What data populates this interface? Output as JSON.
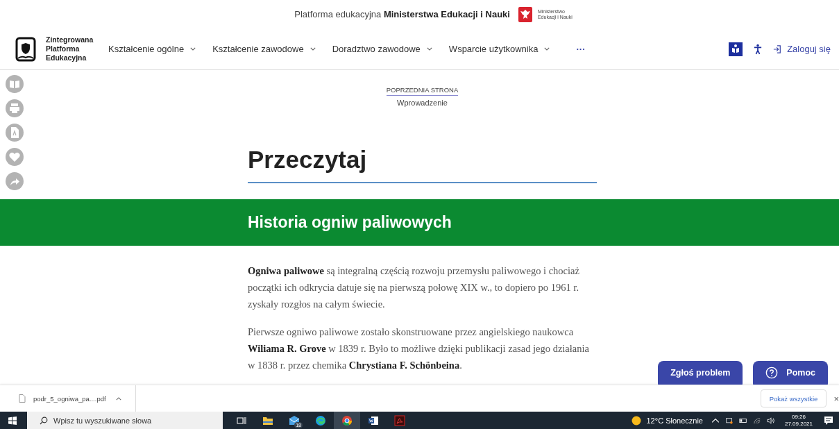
{
  "ministry_bar": {
    "text": "Platforma edukacyjna **Ministerstwa Edukacji i Nauki**",
    "logo_lines": [
      "Ministerstwo",
      "Edukacji i Nauki"
    ]
  },
  "nav": {
    "logo_lines": [
      "Zintegrowana",
      "Platforma",
      "Edukacyjna"
    ],
    "menu": [
      {
        "label": "Kształcenie ogólne",
        "has_dropdown": true
      },
      {
        "label": "Kształcenie zawodowe",
        "has_dropdown": true
      },
      {
        "label": "Doradztwo zawodowe",
        "has_dropdown": true
      },
      {
        "label": "Wsparcie użytkownika",
        "has_dropdown": true
      }
    ],
    "more": "···",
    "login": "Zaloguj się"
  },
  "breadcrumb": {
    "label": "POPRZEDNIA STRONA",
    "link": "Wprowadzenie"
  },
  "page_title": "Przeczytaj",
  "section_title": "Historia ogniw paliwowych",
  "paragraphs": [
    "**Ogniwa paliwowe** są integralną częścią rozwoju przemysłu paliwowego i chociaż początki ich odkrycia datuje się na pierwszą połowę XIX w., to dopiero po 1961 r. zyskały rozgłos na całym świecie.",
    "Pierwsze ogniwo paliwowe zostało skonstruowane przez angielskiego naukowca **Wiliama R. Grove** w 1839 r. Było to możliwe dzięki publikacji zasad jego działania w 1838 r. przez chemika **Chrystiana F. Schönbeina**."
  ],
  "help_buttons": [
    {
      "label": "Zgłoś problem",
      "kind": "plain"
    },
    {
      "label": "Pomoc",
      "kind": "help"
    }
  ],
  "downloads": {
    "file": "podr_5_ogniwa_pa....pdf",
    "show_all": "Pokaż wszystkie",
    "close": "×"
  },
  "taskbar": {
    "search_placeholder": "Wpisz tu wyszukiwane słowa",
    "apps": [
      {
        "kind": "task-view",
        "selected": false
      },
      {
        "kind": "folder",
        "selected": false
      },
      {
        "kind": "mail",
        "selected": false,
        "badge": "18"
      },
      {
        "kind": "edge",
        "selected": false
      },
      {
        "kind": "chrome",
        "selected": true
      },
      {
        "kind": "word",
        "selected": false
      },
      {
        "kind": "acrobat",
        "selected": false
      }
    ],
    "weather": "12°C Słonecznie",
    "time": "09:26",
    "date": "27.09.2021"
  }
}
